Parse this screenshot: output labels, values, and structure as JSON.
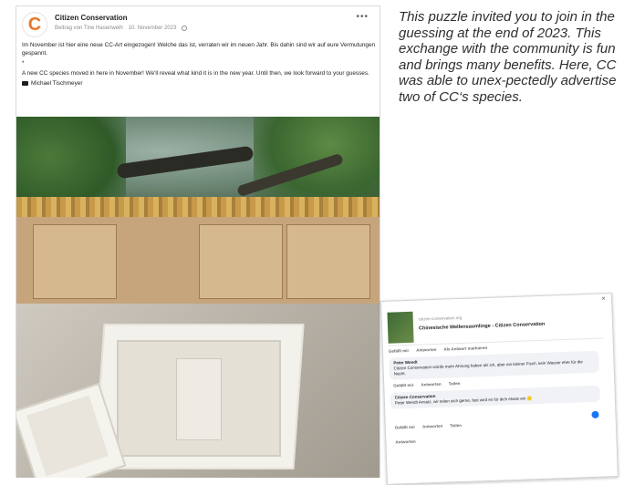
{
  "post": {
    "page_name": "Citizen Conservation",
    "meta": {
      "shared_from": "Beitrag von Tine Hasenweih",
      "date": "10. November 2023"
    },
    "avatar_letter": "C",
    "text_german": "Im November ist hier eine neue CC-Art eingezogen! Welche das ist, verraten wir im neuen Jahr. Bis dahin sind wir auf eure Vermutungen gespannt.",
    "separator": "*",
    "text_english": "A new CC species moved in here in November! We'll reveal what kind it is in the new year. Until then, we look forward to your guesses.",
    "photographer": "Michael Tischmeyer"
  },
  "caption": "This puzzle invited you to join in the guessing at the end of 2023. This exchange with the community is fun and brings many benefits. Here, CC was able to unex-pectedly advertise two of CC‘s species.",
  "comment_card": {
    "link_domain": "citizen-conservation.org",
    "link_title": "Chinesische Wellensaumlinge - Citizen Conservation",
    "actions": [
      "Gefällt mir",
      "Antworten",
      "Als Antwort markieren"
    ],
    "comments": [
      {
        "author": "Peter Wendt",
        "text": "Citizen Conservation würde mehr Ahnung haben als ich, aber ein kleiner Fisch, kein Wasser eher für die Nacht."
      },
      {
        "author": "Citizen Conservation",
        "text": "Peter Wendt Ansatz, wir teilen sich gerne, fast wird es für dich etwas ein"
      }
    ],
    "reply_actions": [
      "Gefällt mir",
      "Antworten",
      "Teilen"
    ],
    "footer_reply": "Antworten"
  },
  "colors": {
    "brand_orange": "#e8782a",
    "facebook_blue": "#1877f2",
    "caption_text": "#2f2f2f"
  }
}
